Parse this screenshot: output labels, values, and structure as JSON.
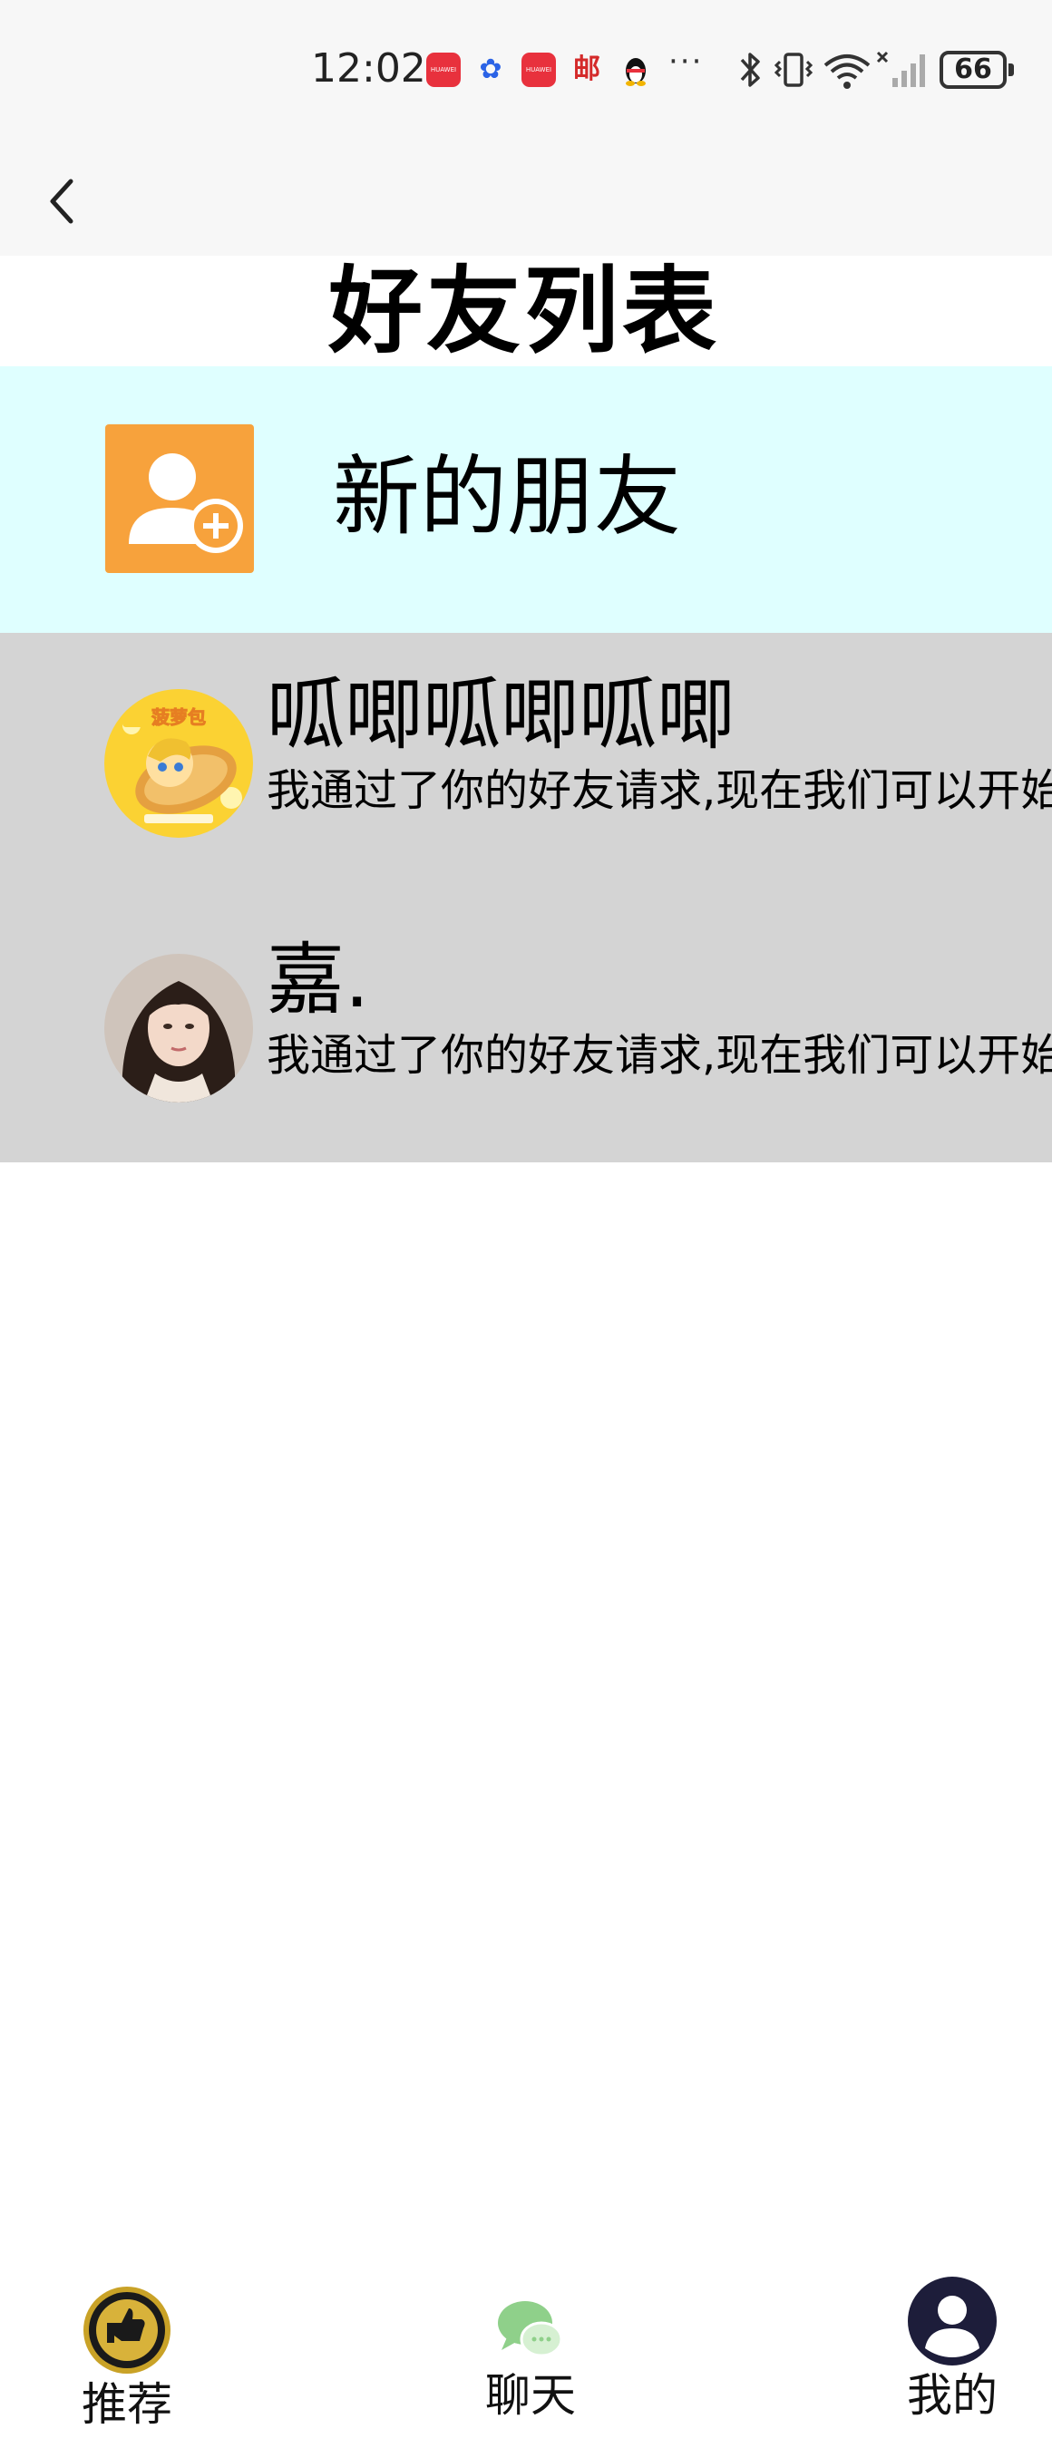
{
  "status_bar": {
    "time": "12:02",
    "battery": "66",
    "more": "···",
    "huawei_text": "HUAWEI",
    "post_icon_text": "邮"
  },
  "nav": {
    "back_icon": "chevron-left-icon"
  },
  "page": {
    "title": "好友列表"
  },
  "new_friends": {
    "label": "新的朋友",
    "icon": "add-user-icon",
    "icon_color": "#f7a23c",
    "row_bg": "#dfffff"
  },
  "friends": [
    {
      "name": "呱唧呱唧呱唧",
      "message": "我通过了你的好友请求,现在我们可以开始聊天了",
      "avatar_text": "菠萝包"
    },
    {
      "name": "嘉.",
      "message": "我通过了你的好友请求,现在我们可以开始聊天了"
    }
  ],
  "tab_bar": {
    "tabs": [
      {
        "label": "推荐",
        "icon": "recommend-badge-icon"
      },
      {
        "label": "聊天",
        "icon": "chat-bubbles-icon"
      },
      {
        "label": "我的",
        "icon": "user-profile-icon"
      }
    ]
  },
  "colors": {
    "list_bg": "#d4d4d4",
    "status_bg": "#f7f7f7",
    "chat_icon": "#8fd08a"
  }
}
